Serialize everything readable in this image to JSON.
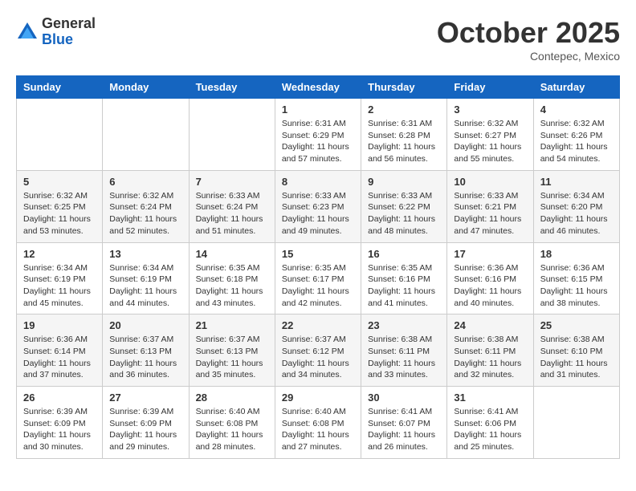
{
  "header": {
    "logo": {
      "general": "General",
      "blue": "Blue"
    },
    "title": "October 2025",
    "subtitle": "Contepec, Mexico"
  },
  "days_of_week": [
    "Sunday",
    "Monday",
    "Tuesday",
    "Wednesday",
    "Thursday",
    "Friday",
    "Saturday"
  ],
  "weeks": [
    [
      {
        "day": "",
        "info": ""
      },
      {
        "day": "",
        "info": ""
      },
      {
        "day": "",
        "info": ""
      },
      {
        "day": "1",
        "info": "Sunrise: 6:31 AM\nSunset: 6:29 PM\nDaylight: 11 hours and 57 minutes."
      },
      {
        "day": "2",
        "info": "Sunrise: 6:31 AM\nSunset: 6:28 PM\nDaylight: 11 hours and 56 minutes."
      },
      {
        "day": "3",
        "info": "Sunrise: 6:32 AM\nSunset: 6:27 PM\nDaylight: 11 hours and 55 minutes."
      },
      {
        "day": "4",
        "info": "Sunrise: 6:32 AM\nSunset: 6:26 PM\nDaylight: 11 hours and 54 minutes."
      }
    ],
    [
      {
        "day": "5",
        "info": "Sunrise: 6:32 AM\nSunset: 6:25 PM\nDaylight: 11 hours and 53 minutes."
      },
      {
        "day": "6",
        "info": "Sunrise: 6:32 AM\nSunset: 6:24 PM\nDaylight: 11 hours and 52 minutes."
      },
      {
        "day": "7",
        "info": "Sunrise: 6:33 AM\nSunset: 6:24 PM\nDaylight: 11 hours and 51 minutes."
      },
      {
        "day": "8",
        "info": "Sunrise: 6:33 AM\nSunset: 6:23 PM\nDaylight: 11 hours and 49 minutes."
      },
      {
        "day": "9",
        "info": "Sunrise: 6:33 AM\nSunset: 6:22 PM\nDaylight: 11 hours and 48 minutes."
      },
      {
        "day": "10",
        "info": "Sunrise: 6:33 AM\nSunset: 6:21 PM\nDaylight: 11 hours and 47 minutes."
      },
      {
        "day": "11",
        "info": "Sunrise: 6:34 AM\nSunset: 6:20 PM\nDaylight: 11 hours and 46 minutes."
      }
    ],
    [
      {
        "day": "12",
        "info": "Sunrise: 6:34 AM\nSunset: 6:19 PM\nDaylight: 11 hours and 45 minutes."
      },
      {
        "day": "13",
        "info": "Sunrise: 6:34 AM\nSunset: 6:19 PM\nDaylight: 11 hours and 44 minutes."
      },
      {
        "day": "14",
        "info": "Sunrise: 6:35 AM\nSunset: 6:18 PM\nDaylight: 11 hours and 43 minutes."
      },
      {
        "day": "15",
        "info": "Sunrise: 6:35 AM\nSunset: 6:17 PM\nDaylight: 11 hours and 42 minutes."
      },
      {
        "day": "16",
        "info": "Sunrise: 6:35 AM\nSunset: 6:16 PM\nDaylight: 11 hours and 41 minutes."
      },
      {
        "day": "17",
        "info": "Sunrise: 6:36 AM\nSunset: 6:16 PM\nDaylight: 11 hours and 40 minutes."
      },
      {
        "day": "18",
        "info": "Sunrise: 6:36 AM\nSunset: 6:15 PM\nDaylight: 11 hours and 38 minutes."
      }
    ],
    [
      {
        "day": "19",
        "info": "Sunrise: 6:36 AM\nSunset: 6:14 PM\nDaylight: 11 hours and 37 minutes."
      },
      {
        "day": "20",
        "info": "Sunrise: 6:37 AM\nSunset: 6:13 PM\nDaylight: 11 hours and 36 minutes."
      },
      {
        "day": "21",
        "info": "Sunrise: 6:37 AM\nSunset: 6:13 PM\nDaylight: 11 hours and 35 minutes."
      },
      {
        "day": "22",
        "info": "Sunrise: 6:37 AM\nSunset: 6:12 PM\nDaylight: 11 hours and 34 minutes."
      },
      {
        "day": "23",
        "info": "Sunrise: 6:38 AM\nSunset: 6:11 PM\nDaylight: 11 hours and 33 minutes."
      },
      {
        "day": "24",
        "info": "Sunrise: 6:38 AM\nSunset: 6:11 PM\nDaylight: 11 hours and 32 minutes."
      },
      {
        "day": "25",
        "info": "Sunrise: 6:38 AM\nSunset: 6:10 PM\nDaylight: 11 hours and 31 minutes."
      }
    ],
    [
      {
        "day": "26",
        "info": "Sunrise: 6:39 AM\nSunset: 6:09 PM\nDaylight: 11 hours and 30 minutes."
      },
      {
        "day": "27",
        "info": "Sunrise: 6:39 AM\nSunset: 6:09 PM\nDaylight: 11 hours and 29 minutes."
      },
      {
        "day": "28",
        "info": "Sunrise: 6:40 AM\nSunset: 6:08 PM\nDaylight: 11 hours and 28 minutes."
      },
      {
        "day": "29",
        "info": "Sunrise: 6:40 AM\nSunset: 6:08 PM\nDaylight: 11 hours and 27 minutes."
      },
      {
        "day": "30",
        "info": "Sunrise: 6:41 AM\nSunset: 6:07 PM\nDaylight: 11 hours and 26 minutes."
      },
      {
        "day": "31",
        "info": "Sunrise: 6:41 AM\nSunset: 6:06 PM\nDaylight: 11 hours and 25 minutes."
      },
      {
        "day": "",
        "info": ""
      }
    ]
  ]
}
